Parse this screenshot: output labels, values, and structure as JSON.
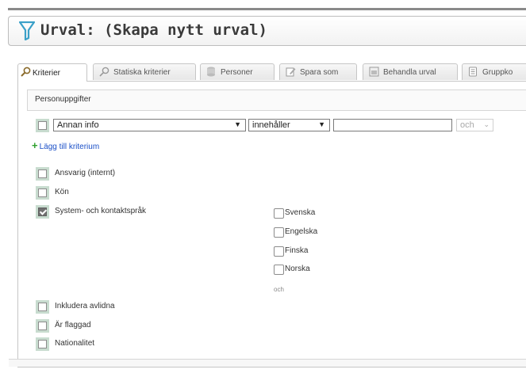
{
  "header": {
    "title": "Urval: (Skapa nytt urval)",
    "icon": "funnel-icon",
    "accent": "#3aa0c8"
  },
  "tabs": [
    {
      "label": "Kriterier",
      "icon": "search-icon",
      "active": true
    },
    {
      "label": "Statiska kriterier",
      "icon": "search-icon"
    },
    {
      "label": "Personer",
      "icon": "database-icon"
    },
    {
      "label": "Spara som",
      "icon": "edit-icon"
    },
    {
      "label": "Behandla urval",
      "icon": "window-icon"
    },
    {
      "label": "Gruppko",
      "icon": "document-icon"
    }
  ],
  "section": {
    "heading": "Personuppgifter"
  },
  "criterion": {
    "field": "Annan info",
    "operator": "innehåller",
    "value": "",
    "connector": "och"
  },
  "add_criterion": "Lägg till kriterium",
  "rows": [
    {
      "label": "Ansvarig (internt)",
      "checked": false
    },
    {
      "label": "Kön",
      "checked": false
    },
    {
      "label": "System- och kontaktspråk",
      "checked": true
    },
    {
      "label": "Inkludera avlidna",
      "checked": false
    },
    {
      "label": "Är flaggad",
      "checked": false
    },
    {
      "label": "Nationalitet",
      "checked": false
    }
  ],
  "language_options": [
    "Svenska",
    "Engelska",
    "Finska",
    "Norska"
  ],
  "language_connector": "och"
}
